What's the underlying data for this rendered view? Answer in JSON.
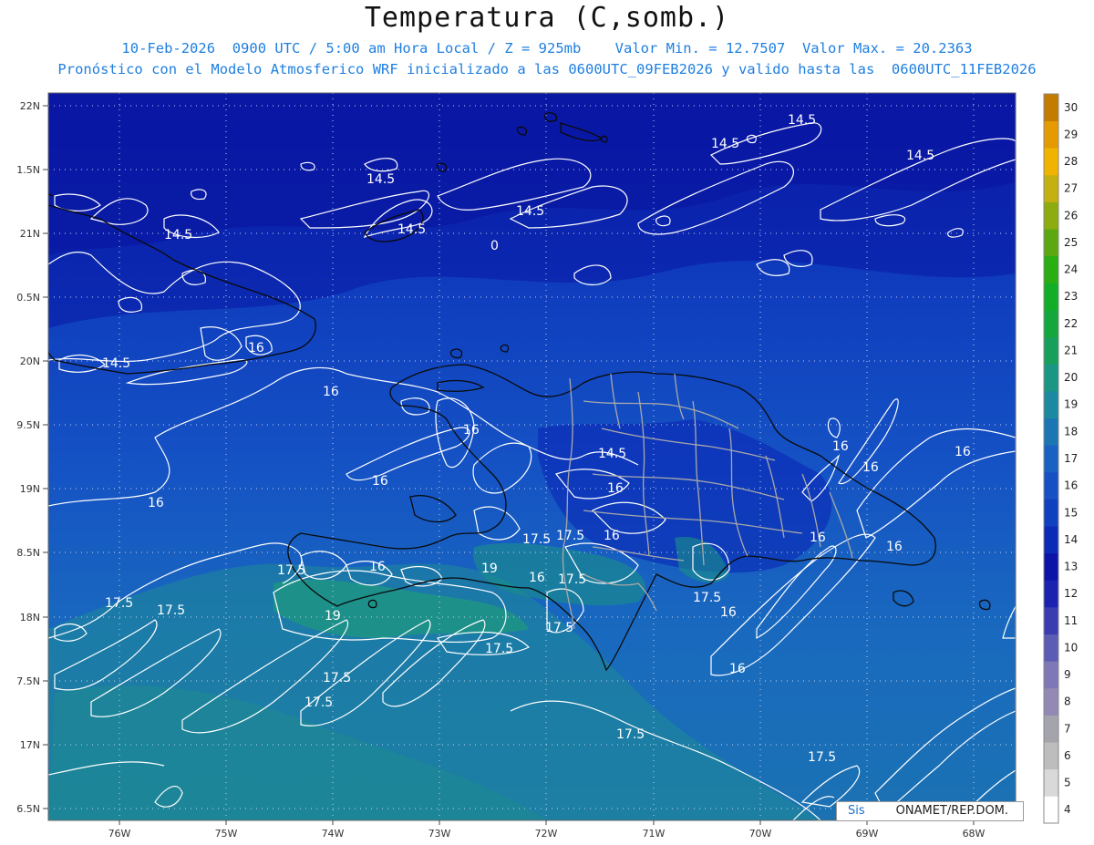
{
  "title": "Temperatura (C,somb.)",
  "subtitle_1": "10-Feb-2026  0900 UTC / 5:00 am Hora Local / Z = 925mb    Valor Min. = 12.7507  Valor Max. = 20.2363",
  "subtitle_2": "Pronóstico con el Modelo Atmosferico WRF inicializado a las 0600UTC_09FEB2026 y valido hasta las  0600UTC_11FEB2026",
  "credit": {
    "left": "Sis",
    "right": "ONAMET/REP.DOM."
  },
  "lat_labels": [
    "22N",
    "1.5N",
    "21N",
    "0.5N",
    "20N",
    "9.5N",
    "19N",
    "8.5N",
    "18N",
    "7.5N",
    "17N",
    "6.5N"
  ],
  "lon_labels": [
    "76W",
    "75W",
    "74W",
    "73W",
    "72W",
    "71W",
    "70W",
    "69W",
    "68W"
  ],
  "colorbar": {
    "labels": [
      "4",
      "5",
      "6",
      "7",
      "8",
      "9",
      "10",
      "11",
      "12",
      "13",
      "14",
      "15",
      "16",
      "17",
      "18",
      "19",
      "20",
      "21",
      "22",
      "23",
      "24",
      "25",
      "26",
      "27",
      "28",
      "29",
      "30"
    ],
    "colors": [
      "#ffffff",
      "#d9d9d9",
      "#bdbdbd",
      "#a4a4ac",
      "#9488b4",
      "#7e78b6",
      "#5d5cb4",
      "#3a3cb0",
      "#1c22b0",
      "#0c14a8",
      "#0b2ab8",
      "#0f40c0",
      "#1750c4",
      "#1a62c2",
      "#1c76b4",
      "#1b8aa0",
      "#1a9684",
      "#16a05c",
      "#14a83c",
      "#12ae28",
      "#2aae14",
      "#5ca810",
      "#8cac10",
      "#c4b010",
      "#f0b400",
      "#e49a00",
      "#c47c00"
    ]
  },
  "contour_labels": [
    {
      "text": "14.5"
    },
    {
      "text": "14.5"
    },
    {
      "text": "14.5"
    },
    {
      "text": "14.5"
    },
    {
      "text": "14.5"
    },
    {
      "text": "14.5"
    },
    {
      "text": "14.5"
    },
    {
      "text": "14.5"
    },
    {
      "text": "0"
    },
    {
      "text": "16"
    },
    {
      "text": "16"
    },
    {
      "text": "16"
    },
    {
      "text": "16"
    },
    {
      "text": "14.5"
    },
    {
      "text": "16"
    },
    {
      "text": "16"
    },
    {
      "text": "16"
    },
    {
      "text": "16"
    },
    {
      "text": "16"
    },
    {
      "text": "16"
    },
    {
      "text": "17.5"
    },
    {
      "text": "17.5"
    },
    {
      "text": "17.5"
    },
    {
      "text": "17.5"
    },
    {
      "text": "16"
    },
    {
      "text": "19"
    },
    {
      "text": "16"
    },
    {
      "text": "17.5"
    },
    {
      "text": "17.5"
    },
    {
      "text": "16"
    },
    {
      "text": "16"
    },
    {
      "text": "17.5"
    },
    {
      "text": "17.5"
    },
    {
      "text": "19"
    },
    {
      "text": "17.5"
    },
    {
      "text": "17.5"
    },
    {
      "text": "17.5"
    },
    {
      "text": "17.5"
    },
    {
      "text": "16"
    },
    {
      "text": "17.5"
    },
    {
      "text": "17.5"
    },
    {
      "text": "16"
    }
  ]
}
